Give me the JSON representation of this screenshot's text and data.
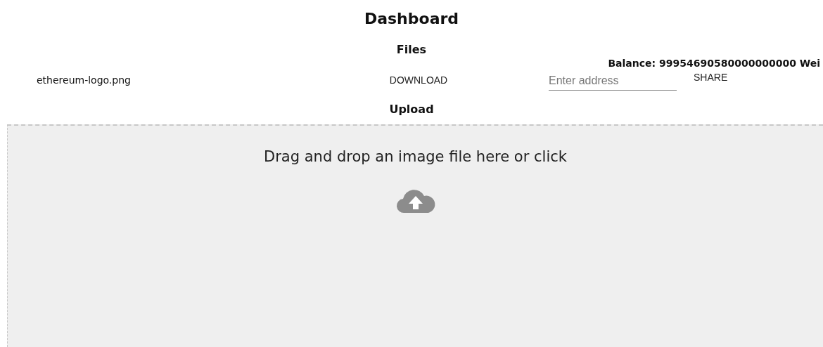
{
  "title": "Dashboard",
  "files_heading": "Files",
  "balance": "Balance: 99954690580000000000 Wei",
  "files": [
    {
      "name": "ethereum-logo.png",
      "download": "DOWNLOAD",
      "address": {
        "placeholder": "Enter address"
      },
      "share": "SHARE"
    }
  ],
  "upload_heading": "Upload",
  "dropzone": {
    "text": "Drag and drop an image file here or click"
  }
}
